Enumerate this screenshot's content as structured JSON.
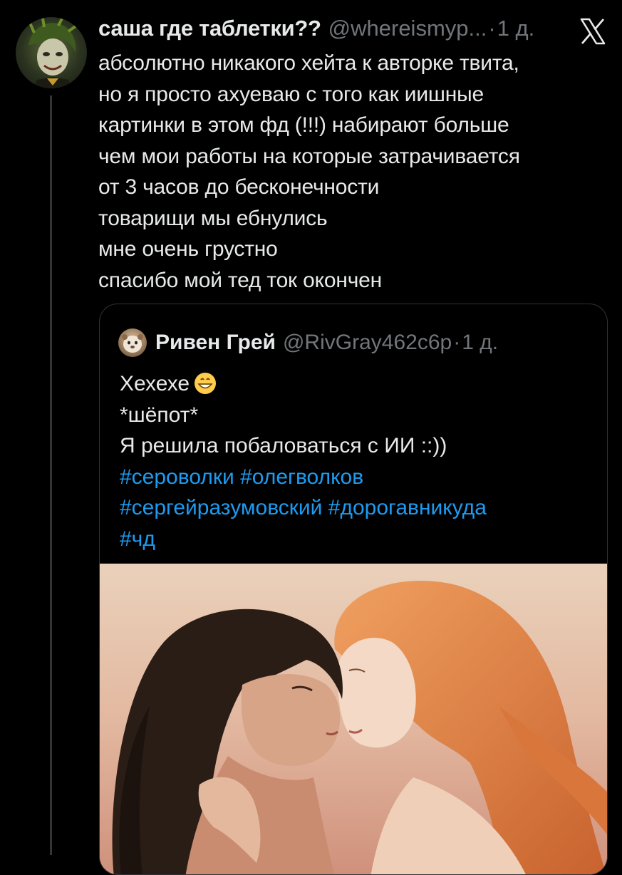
{
  "tweet": {
    "author": {
      "display_name": "саша где таблетки??",
      "handle": "@whereismyp...",
      "separator": "·",
      "timestamp": "1 д."
    },
    "platform_icon": "x-logo-icon",
    "lines": [
      "абсолютно никакого хейта к авторке твита,",
      "но я просто ахуеваю с того как иишные",
      "картинки в этом фд (!!!) набирают больше",
      "чем мои работы на которые затрачивается",
      "от 3 часов до бесконечности",
      "товарищи мы ебнулись",
      "мне очень грустно",
      "спасибо мой тед ток окончен"
    ]
  },
  "quoted": {
    "author": {
      "display_name": "Ривен Грей",
      "handle": "@RivGray462c6p",
      "separator": "·",
      "timestamp": "1 д."
    },
    "line1_text": "Хехехе",
    "line1_emoji": "grinning-face-emoji",
    "line2": "*шёпот*",
    "line3": "Я решила побаловаться с ИИ  ::))",
    "hashtags_line1": [
      "#сероволки",
      "#олегволков"
    ],
    "hashtags_line2": [
      "#сергейразумовский",
      "#дорогавникуда"
    ],
    "hashtags_line3": [
      "#чд"
    ],
    "media": "illustration-image"
  },
  "colors": {
    "background": "#000000",
    "text": "#e7e9ea",
    "secondary": "#71767b",
    "link": "#1d9bf0",
    "border": "#2f3336"
  }
}
